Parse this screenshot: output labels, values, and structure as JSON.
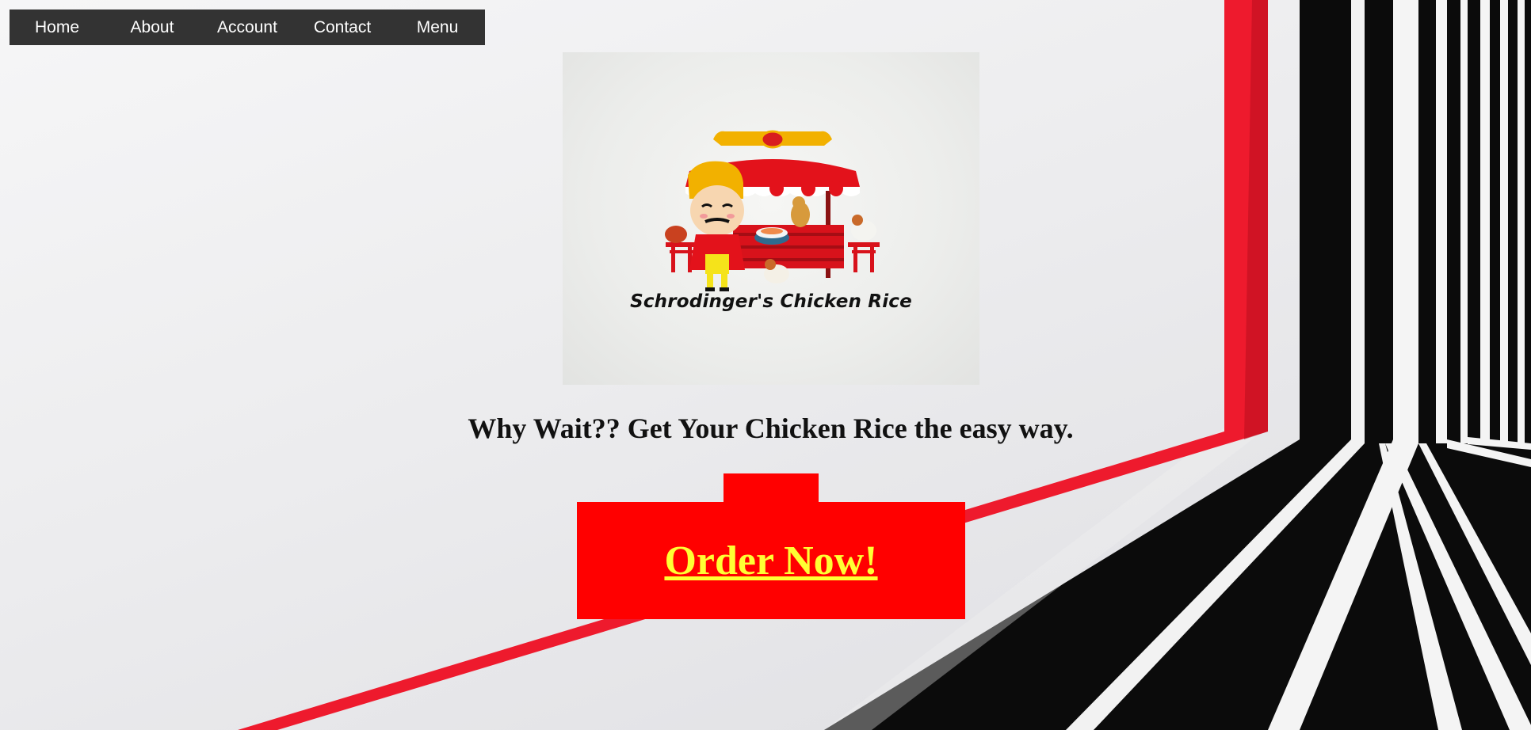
{
  "nav": {
    "items": [
      {
        "label": "Home"
      },
      {
        "label": "About"
      },
      {
        "label": "Account"
      },
      {
        "label": "Contact"
      },
      {
        "label": "Menu"
      }
    ]
  },
  "logo": {
    "brand_text": "Schrodinger's Chicken Rice",
    "icon": "chicken-rice-stall-logo"
  },
  "hero": {
    "tagline": "Why Wait?? Get Your Chicken Rice the easy way."
  },
  "cta": {
    "label": "Order Now!"
  },
  "colors": {
    "nav_background": "#333333",
    "cta_background": "#ff0000",
    "cta_text": "#ffff33",
    "accent_red": "#f0122a"
  }
}
